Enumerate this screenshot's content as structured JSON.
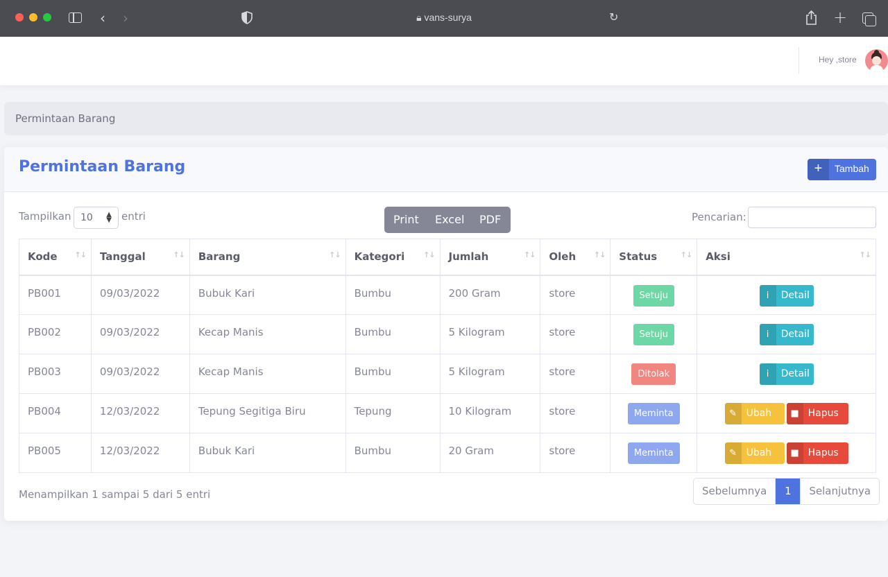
{
  "browser": {
    "url": "vans-surya"
  },
  "topbar": {
    "greeting": "Hey ,store"
  },
  "breadcrumb": "Permintaan Barang",
  "card": {
    "title": "Permintaan Barang",
    "add_label": "Tambah"
  },
  "controls": {
    "show_label": "Tampilkan",
    "length_value": "10",
    "entries_label": "entri",
    "export_buttons": [
      "Print",
      "Excel",
      "PDF"
    ],
    "search_label": "Pencarian:",
    "search_value": ""
  },
  "table": {
    "headers": [
      "Kode",
      "Tanggal",
      "Barang",
      "Kategori",
      "Jumlah",
      "Oleh",
      "Status",
      "Aksi"
    ],
    "rows": [
      {
        "kode": "PB001",
        "tanggal": "09/03/2022",
        "barang": "Bubuk Kari",
        "kategori": "Bumbu",
        "jumlah": "200 Gram",
        "oleh": "store",
        "status": "Setuju",
        "actions": [
          "Detail"
        ]
      },
      {
        "kode": "PB002",
        "tanggal": "09/03/2022",
        "barang": "Kecap Manis",
        "kategori": "Bumbu",
        "jumlah": "5 Kilogram",
        "oleh": "store",
        "status": "Setuju",
        "actions": [
          "Detail"
        ]
      },
      {
        "kode": "PB003",
        "tanggal": "09/03/2022",
        "barang": "Kecap Manis",
        "kategori": "Bumbu",
        "jumlah": "5 Kilogram",
        "oleh": "store",
        "status": "Ditolak",
        "actions": [
          "Detail"
        ]
      },
      {
        "kode": "PB004",
        "tanggal": "12/03/2022",
        "barang": "Tepung Segitiga Biru",
        "kategori": "Tepung",
        "jumlah": "10 Kilogram",
        "oleh": "store",
        "status": "Meminta",
        "actions": [
          "Ubah",
          "Hapus"
        ]
      },
      {
        "kode": "PB005",
        "tanggal": "12/03/2022",
        "barang": "Bubuk Kari",
        "kategori": "Bumbu",
        "jumlah": "20 Gram",
        "oleh": "store",
        "status": "Meminta",
        "actions": [
          "Ubah",
          "Hapus"
        ]
      }
    ]
  },
  "footer": {
    "info": "Menampilkan 1 sampai 5 dari 5 entri",
    "prev": "Sebelumnya",
    "page": "1",
    "next": "Selanjutnya"
  },
  "colors": {
    "primary": "#4e73df",
    "info": "#36b9cc",
    "warning": "#f6c23e",
    "danger": "#e74a3b",
    "success_badge": "#6dd7a6",
    "danger_badge": "#f0867f",
    "primary_badge": "#8ea7ee"
  }
}
